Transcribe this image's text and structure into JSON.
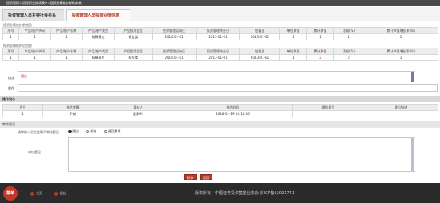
{
  "breadcrumb": "投资管理人员投资业情况表>>投资业情维护机构审核",
  "tabs": [
    {
      "label": "投资管理人员主要社会关系"
    },
    {
      "label": "投资管理人员投资业情信息"
    }
  ],
  "section1": {
    "label": "投资业情维护前信息",
    "headers": [
      "序号",
      "产品/账户代码",
      "产品/账户名称",
      "产品/账户类型",
      "产品投资类型",
      "投资管理起始日",
      "投资管理终止日",
      "估值日",
      "单位净值",
      "累计净值",
      "涨幅(%)",
      "累计净值增长率(%)"
    ],
    "row": [
      "1",
      "1",
      "1",
      "私募基金",
      "权益类",
      "2010-01-01",
      "2013-01-01",
      "2013-01-01",
      "1",
      "1",
      "1",
      "1"
    ]
  },
  "section2": {
    "label": "投资业情维护后信息",
    "headers": [
      "序号",
      "产品/账户代码",
      "产品/账户名称",
      "产品/账户类型",
      "产品投资类型",
      "投资管理起始日",
      "投资管理终止日",
      "估值日",
      "单位净值",
      "累计净值",
      "涨幅(%)",
      "累计净值增长率(%)"
    ],
    "row": [
      "1",
      "1",
      "1",
      "私募基金",
      "权益类",
      "2010-01-01",
      "2013-01-01",
      "2013-01-01",
      "1",
      "2",
      "2",
      "1"
    ]
  },
  "description": {
    "label": "描述",
    "value": "通过"
  },
  "attachment": {
    "label": "附件"
  },
  "process": {
    "title": "操作流水",
    "headers": [
      "序号",
      "操作步骤",
      "操作人",
      "操作时间",
      "操作意见",
      "意见描述"
    ],
    "row": [
      "1",
      "开始",
      "尾野92",
      "2018-01-19 16:13:06",
      "",
      ""
    ]
  },
  "review": {
    "title": "审核意见",
    "prompt": "请审核人员在此填写审核意见",
    "options": [
      {
        "label": "通过",
        "selected": true
      },
      {
        "label": "拒绝",
        "selected": false
      },
      {
        "label": "退回重填",
        "selected": false
      }
    ],
    "opinion_label": "审核意见",
    "opinion_value": ""
  },
  "buttons": {
    "submit": "提交",
    "back": "返回"
  },
  "footer": {
    "menu": "菜单",
    "home": "主页",
    "logout": "退出",
    "copyright": "版权所有：中国证券投资基金业协会 京ICP备12021741"
  },
  "colors": {
    "accent": "#c0392b",
    "footer_bg": "#2b2b2b",
    "topbar_bg": "#4a4a4a"
  }
}
